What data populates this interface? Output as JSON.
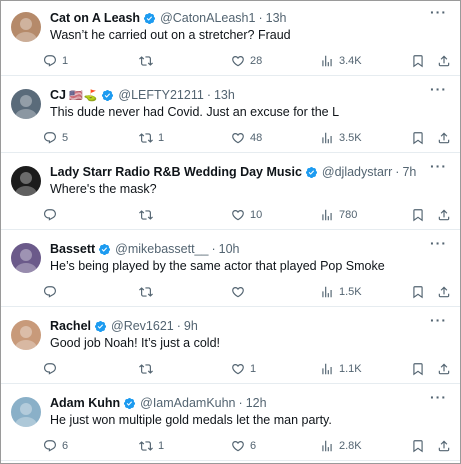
{
  "tweets": [
    {
      "name": "Cat on A Leash",
      "emoji": "",
      "handle": "@CatonALeash1",
      "time": "13h",
      "text": "Wasn’t he carried out on a stretcher? Fraud",
      "replies": "1",
      "retweets": "",
      "likes": "28",
      "views": "3.4K",
      "avatar_color": "#b58a6a",
      "avatar_icon": "cat-photo"
    },
    {
      "name": "CJ",
      "emoji": "🇺🇸⛳",
      "handle": "@LEFTY21211",
      "time": "13h",
      "text": "This dude never had Covid.  Just an excuse for the L",
      "replies": "5",
      "retweets": "1",
      "likes": "48",
      "views": "3.5K",
      "avatar_color": "#5a6b7a",
      "avatar_icon": "person-photo"
    },
    {
      "name": "Lady Starr Radio R&B Wedding Day Music",
      "emoji": "",
      "handle": "@djladystarr",
      "time": "7h",
      "text": "Where's the mask?",
      "replies": "",
      "retweets": "",
      "likes": "10",
      "views": "780",
      "avatar_color": "#1c1c1c",
      "avatar_icon": "person-photo"
    },
    {
      "name": "Bassett",
      "emoji": "",
      "handle": "@mikebassett__",
      "time": "10h",
      "text": "He’s being played by the same actor that played Pop Smoke",
      "replies": "",
      "retweets": "",
      "likes": "",
      "views": "1.5K",
      "avatar_color": "#6b5a8a",
      "avatar_icon": "person-photo"
    },
    {
      "name": "Rachel",
      "emoji": "",
      "handle": "@Rev1621",
      "time": "9h",
      "text": "Good job Noah! It’s just a cold!",
      "replies": "",
      "retweets": "",
      "likes": "1",
      "views": "1.1K",
      "avatar_color": "#c89a7a",
      "avatar_icon": "person-photo"
    },
    {
      "name": "Adam Kuhn",
      "emoji": "",
      "handle": "@IamAdamKuhn",
      "time": "12h",
      "text": "He just won multiple gold medals let the man party.",
      "replies": "6",
      "retweets": "1",
      "likes": "6",
      "views": "2.8K",
      "avatar_color": "#8ab0c8",
      "avatar_icon": "person-photo"
    }
  ],
  "colors": {
    "verified": "#1d9bf0",
    "secondary_text": "#536471",
    "primary_text": "#0f1419"
  }
}
